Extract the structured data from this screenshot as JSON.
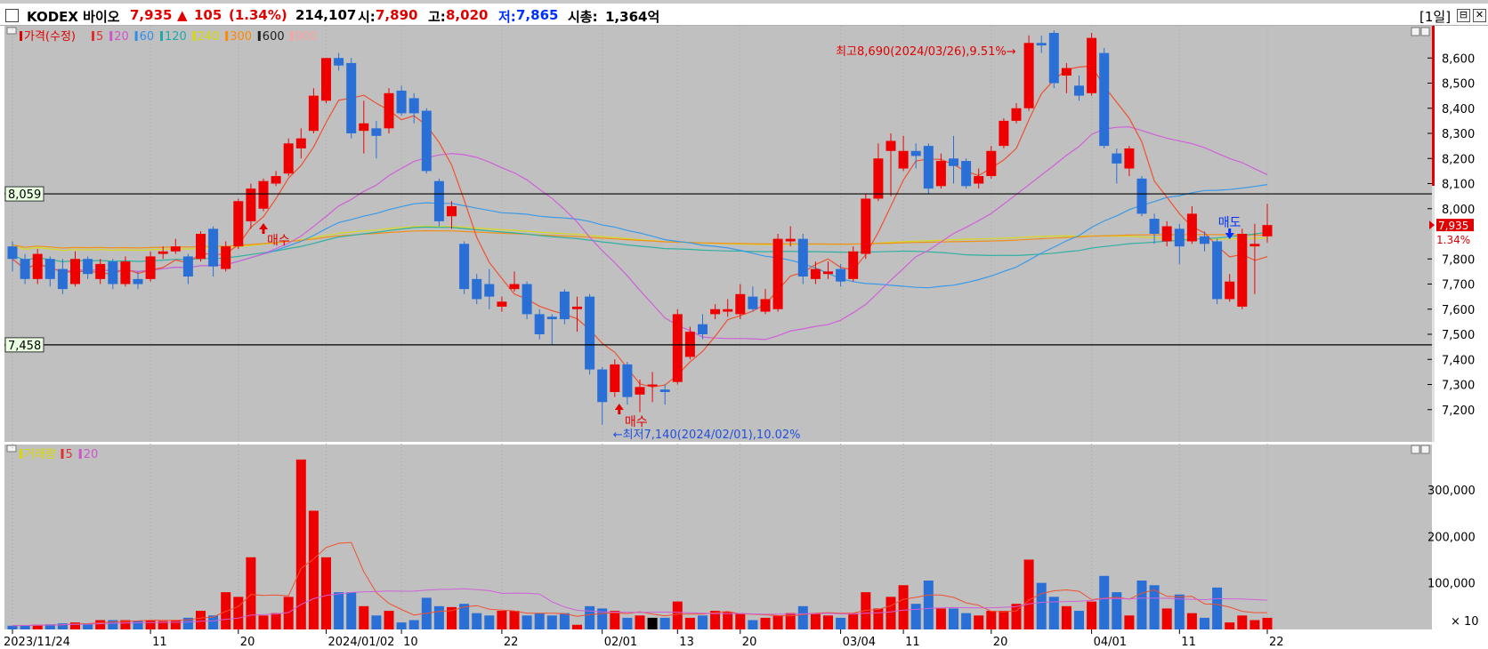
{
  "header": {
    "name": "KODEX 바이오",
    "price": "7,935",
    "change_arrow": "▲",
    "change": "105",
    "change_pct": "(1.34%)",
    "volume": "214,107",
    "open_label": "시:",
    "open": "7,890",
    "high_label": "고:",
    "high": "8,020",
    "low_label": "저:",
    "low": "7,865",
    "mcap_label": "시총:",
    "mcap": "1,364억",
    "period": "[1일]",
    "btn_restore": "⊟",
    "btn_close": "✕"
  },
  "price_legend": [
    {
      "text": "가격(수정)",
      "color": "#e00000"
    },
    {
      "text": "5",
      "color": "#e03030"
    },
    {
      "text": "20",
      "color": "#cc55cc"
    },
    {
      "text": "60",
      "color": "#2f8fe8"
    },
    {
      "text": "120",
      "color": "#20a8a8"
    },
    {
      "text": "240",
      "color": "#d8d800"
    },
    {
      "text": "300",
      "color": "#ff8800"
    },
    {
      "text": "600",
      "color": "#202020"
    },
    {
      "text": "900",
      "color": "#ffa0a0"
    }
  ],
  "volume_legend": [
    {
      "text": "거래량",
      "color": "#d8d800"
    },
    {
      "text": "5",
      "color": "#e03030"
    },
    {
      "text": "20",
      "color": "#cc55cc"
    }
  ],
  "price_axis": [
    "8,600",
    "8,500",
    "8,400",
    "8,300",
    "8,200",
    "8,100",
    "8,000",
    "7,800",
    "7,700",
    "7,600",
    "7,500",
    "7,400",
    "7,300",
    "7,200"
  ],
  "volume_axis": [
    "300,000",
    "200,000",
    "100,000"
  ],
  "volume_axis_unit": "× 10",
  "hlines": {
    "upper": "8,059",
    "lower": "7,458"
  },
  "current_price_tag": "7,935",
  "current_pct_tag": "1.34%",
  "x_labels": [
    "2023/11/24",
    "11",
    "20",
    "2024/01/02",
    "10",
    "22",
    "02/01",
    "13",
    "20",
    "03/04",
    "11",
    "20",
    "04/01",
    "11",
    "22"
  ],
  "annotations": {
    "high": "최고8,690(2024/03/26),9.51%→",
    "low": "←최저7,140(2024/02/01),10.02%",
    "buy1": "매수",
    "buy2": "매수",
    "sell": "매도"
  },
  "colors": {
    "chart_bg": "#c0c0c0",
    "up": "#ee0000",
    "down": "#2a6fd6",
    "ma5": "#f05030",
    "ma20": "#d060d8",
    "ma60": "#3a9ae8",
    "ma120": "#30b0a0",
    "ma240": "#d8d820",
    "ma300": "#f09018"
  },
  "chart_data": {
    "type": "candlestick",
    "price_ylim": [
      7100,
      8700
    ],
    "volume_ylim": [
      0,
      380000
    ],
    "candles": [
      {
        "o": 7850,
        "c": 7800,
        "h": 7870,
        "l": 7750,
        "v": 8000
      },
      {
        "o": 7800,
        "c": 7720,
        "h": 7820,
        "l": 7700,
        "v": 9000
      },
      {
        "o": 7720,
        "c": 7820,
        "h": 7840,
        "l": 7700,
        "v": 10000
      },
      {
        "o": 7800,
        "c": 7720,
        "h": 7810,
        "l": 7690,
        "v": 11000
      },
      {
        "o": 7760,
        "c": 7680,
        "h": 7800,
        "l": 7660,
        "v": 13000
      },
      {
        "o": 7700,
        "c": 7800,
        "h": 7830,
        "l": 7690,
        "v": 15000
      },
      {
        "o": 7800,
        "c": 7740,
        "h": 7810,
        "l": 7720,
        "v": 13000
      },
      {
        "o": 7720,
        "c": 7780,
        "h": 7800,
        "l": 7700,
        "v": 20000
      },
      {
        "o": 7790,
        "c": 7700,
        "h": 7800,
        "l": 7680,
        "v": 20000
      },
      {
        "o": 7700,
        "c": 7790,
        "h": 7810,
        "l": 7690,
        "v": 20000
      },
      {
        "o": 7720,
        "c": 7700,
        "h": 7750,
        "l": 7680,
        "v": 19000
      },
      {
        "o": 7720,
        "c": 7810,
        "h": 7830,
        "l": 7710,
        "v": 20000
      },
      {
        "o": 7820,
        "c": 7830,
        "h": 7850,
        "l": 7800,
        "v": 18000
      },
      {
        "o": 7830,
        "c": 7850,
        "h": 7880,
        "l": 7820,
        "v": 20000
      },
      {
        "o": 7810,
        "c": 7730,
        "h": 7820,
        "l": 7700,
        "v": 25000
      },
      {
        "o": 7800,
        "c": 7900,
        "h": 7910,
        "l": 7790,
        "v": 40000
      },
      {
        "o": 7920,
        "c": 7770,
        "h": 7930,
        "l": 7730,
        "v": 30000
      },
      {
        "o": 7760,
        "c": 7850,
        "h": 7870,
        "l": 7750,
        "v": 80000
      },
      {
        "o": 7850,
        "c": 8030,
        "h": 8040,
        "l": 7840,
        "v": 70000
      },
      {
        "o": 7950,
        "c": 8080,
        "h": 8100,
        "l": 7920,
        "v": 155000
      },
      {
        "o": 8000,
        "c": 8110,
        "h": 8120,
        "l": 7990,
        "v": 30000
      },
      {
        "o": 8100,
        "c": 8130,
        "h": 8150,
        "l": 8090,
        "v": 35000
      },
      {
        "o": 8140,
        "c": 8260,
        "h": 8280,
        "l": 8130,
        "v": 70000
      },
      {
        "o": 8240,
        "c": 8280,
        "h": 8320,
        "l": 8200,
        "v": 365000
      },
      {
        "o": 8310,
        "c": 8450,
        "h": 8480,
        "l": 8300,
        "v": 255000
      },
      {
        "o": 8430,
        "c": 8600,
        "h": 8600,
        "l": 8420,
        "v": 155000
      },
      {
        "o": 8600,
        "c": 8570,
        "h": 8620,
        "l": 8550,
        "v": 80000
      },
      {
        "o": 8580,
        "c": 8300,
        "h": 8600,
        "l": 8280,
        "v": 80000
      },
      {
        "o": 8310,
        "c": 8340,
        "h": 8430,
        "l": 8220,
        "v": 50000
      },
      {
        "o": 8320,
        "c": 8290,
        "h": 8350,
        "l": 8200,
        "v": 30000
      },
      {
        "o": 8320,
        "c": 8460,
        "h": 8480,
        "l": 8300,
        "v": 40000
      },
      {
        "o": 8470,
        "c": 8380,
        "h": 8490,
        "l": 8370,
        "v": 15000
      },
      {
        "o": 8440,
        "c": 8380,
        "h": 8460,
        "l": 8340,
        "v": 20000
      },
      {
        "o": 8390,
        "c": 8150,
        "h": 8400,
        "l": 8140,
        "v": 68000
      },
      {
        "o": 8110,
        "c": 7950,
        "h": 8120,
        "l": 7930,
        "v": 50000
      },
      {
        "o": 7970,
        "c": 8010,
        "h": 8030,
        "l": 7920,
        "v": 48000
      },
      {
        "o": 7860,
        "c": 7680,
        "h": 7870,
        "l": 7660,
        "v": 55000
      },
      {
        "o": 7720,
        "c": 7640,
        "h": 7740,
        "l": 7620,
        "v": 35000
      },
      {
        "o": 7700,
        "c": 7650,
        "h": 7760,
        "l": 7600,
        "v": 30000
      },
      {
        "o": 7610,
        "c": 7630,
        "h": 7650,
        "l": 7590,
        "v": 40000
      },
      {
        "o": 7680,
        "c": 7700,
        "h": 7750,
        "l": 7670,
        "v": 40000
      },
      {
        "o": 7700,
        "c": 7580,
        "h": 7710,
        "l": 7560,
        "v": 30000
      },
      {
        "o": 7580,
        "c": 7500,
        "h": 7600,
        "l": 7480,
        "v": 35000
      },
      {
        "o": 7570,
        "c": 7560,
        "h": 7580,
        "l": 7460,
        "v": 30000
      },
      {
        "o": 7670,
        "c": 7560,
        "h": 7680,
        "l": 7540,
        "v": 35000
      },
      {
        "o": 7600,
        "c": 7610,
        "h": 7650,
        "l": 7510,
        "v": 10000
      },
      {
        "o": 7650,
        "c": 7360,
        "h": 7660,
        "l": 7340,
        "v": 50000
      },
      {
        "o": 7360,
        "c": 7230,
        "h": 7370,
        "l": 7140,
        "v": 45000
      },
      {
        "o": 7270,
        "c": 7380,
        "h": 7400,
        "l": 7250,
        "v": 40000
      },
      {
        "o": 7380,
        "c": 7250,
        "h": 7390,
        "l": 7220,
        "v": 25000
      },
      {
        "o": 7260,
        "c": 7290,
        "h": 7320,
        "l": 7190,
        "v": 30000
      },
      {
        "o": 7300,
        "c": 7300,
        "h": 7350,
        "l": 7230,
        "v": 25000
      },
      {
        "o": 7280,
        "c": 7270,
        "h": 7300,
        "l": 7220,
        "v": 25000
      },
      {
        "o": 7310,
        "c": 7580,
        "h": 7600,
        "l": 7300,
        "v": 60000
      },
      {
        "o": 7410,
        "c": 7510,
        "h": 7530,
        "l": 7400,
        "v": 25000
      },
      {
        "o": 7540,
        "c": 7500,
        "h": 7580,
        "l": 7480,
        "v": 30000
      },
      {
        "o": 7580,
        "c": 7600,
        "h": 7620,
        "l": 7560,
        "v": 40000
      },
      {
        "o": 7590,
        "c": 7600,
        "h": 7640,
        "l": 7570,
        "v": 38000
      },
      {
        "o": 7580,
        "c": 7660,
        "h": 7700,
        "l": 7560,
        "v": 35000
      },
      {
        "o": 7650,
        "c": 7600,
        "h": 7690,
        "l": 7590,
        "v": 20000
      },
      {
        "o": 7590,
        "c": 7640,
        "h": 7680,
        "l": 7580,
        "v": 25000
      },
      {
        "o": 7600,
        "c": 7880,
        "h": 7900,
        "l": 7590,
        "v": 30000
      },
      {
        "o": 7870,
        "c": 7880,
        "h": 7930,
        "l": 7850,
        "v": 35000
      },
      {
        "o": 7880,
        "c": 7730,
        "h": 7900,
        "l": 7700,
        "v": 50000
      },
      {
        "o": 7720,
        "c": 7760,
        "h": 7790,
        "l": 7700,
        "v": 35000
      },
      {
        "o": 7740,
        "c": 7750,
        "h": 7790,
        "l": 7720,
        "v": 30000
      },
      {
        "o": 7760,
        "c": 7710,
        "h": 7780,
        "l": 7690,
        "v": 25000
      },
      {
        "o": 7720,
        "c": 7830,
        "h": 7850,
        "l": 7710,
        "v": 35000
      },
      {
        "o": 7820,
        "c": 8040,
        "h": 8060,
        "l": 7800,
        "v": 80000
      },
      {
        "o": 8040,
        "c": 8200,
        "h": 8260,
        "l": 8030,
        "v": 45000
      },
      {
        "o": 8230,
        "c": 8270,
        "h": 8300,
        "l": 8050,
        "v": 70000
      },
      {
        "o": 8160,
        "c": 8230,
        "h": 8290,
        "l": 8150,
        "v": 95000
      },
      {
        "o": 8230,
        "c": 8210,
        "h": 8260,
        "l": 8160,
        "v": 55000
      },
      {
        "o": 8250,
        "c": 8080,
        "h": 8260,
        "l": 8060,
        "v": 105000
      },
      {
        "o": 8090,
        "c": 8190,
        "h": 8220,
        "l": 8080,
        "v": 45000
      },
      {
        "o": 8200,
        "c": 8170,
        "h": 8290,
        "l": 8100,
        "v": 45000
      },
      {
        "o": 8190,
        "c": 8090,
        "h": 8200,
        "l": 8080,
        "v": 35000
      },
      {
        "o": 8100,
        "c": 8130,
        "h": 8160,
        "l": 8080,
        "v": 30000
      },
      {
        "o": 8130,
        "c": 8230,
        "h": 8250,
        "l": 8120,
        "v": 40000
      },
      {
        "o": 8250,
        "c": 8350,
        "h": 8360,
        "l": 8240,
        "v": 40000
      },
      {
        "o": 8350,
        "c": 8400,
        "h": 8420,
        "l": 8340,
        "v": 55000
      },
      {
        "o": 8400,
        "c": 8660,
        "h": 8690,
        "l": 8390,
        "v": 150000
      },
      {
        "o": 8660,
        "c": 8650,
        "h": 8690,
        "l": 8620,
        "v": 100000
      },
      {
        "o": 8700,
        "c": 8500,
        "h": 8710,
        "l": 8480,
        "v": 70000
      },
      {
        "o": 8530,
        "c": 8560,
        "h": 8580,
        "l": 8460,
        "v": 50000
      },
      {
        "o": 8490,
        "c": 8450,
        "h": 8530,
        "l": 8430,
        "v": 40000
      },
      {
        "o": 8460,
        "c": 8680,
        "h": 8700,
        "l": 8450,
        "v": 60000
      },
      {
        "o": 8620,
        "c": 8250,
        "h": 8640,
        "l": 8240,
        "v": 115000
      },
      {
        "o": 8220,
        "c": 8180,
        "h": 8240,
        "l": 8100,
        "v": 80000
      },
      {
        "o": 8160,
        "c": 8240,
        "h": 8250,
        "l": 8130,
        "v": 30000
      },
      {
        "o": 8120,
        "c": 7980,
        "h": 8130,
        "l": 7970,
        "v": 105000
      },
      {
        "o": 7960,
        "c": 7900,
        "h": 7980,
        "l": 7860,
        "v": 95000
      },
      {
        "o": 7870,
        "c": 7930,
        "h": 7950,
        "l": 7850,
        "v": 45000
      },
      {
        "o": 7920,
        "c": 7850,
        "h": 7940,
        "l": 7780,
        "v": 75000
      },
      {
        "o": 7870,
        "c": 7980,
        "h": 8010,
        "l": 7860,
        "v": 35000
      },
      {
        "o": 7890,
        "c": 7860,
        "h": 7910,
        "l": 7830,
        "v": 25000
      },
      {
        "o": 7870,
        "c": 7640,
        "h": 7880,
        "l": 7620,
        "v": 90000
      },
      {
        "o": 7640,
        "c": 7710,
        "h": 7740,
        "l": 7630,
        "v": 15000
      },
      {
        "o": 7610,
        "c": 7900,
        "h": 7920,
        "l": 7600,
        "v": 30000
      },
      {
        "o": 7850,
        "c": 7860,
        "h": 7940,
        "l": 7660,
        "v": 20000
      },
      {
        "o": 7890,
        "c": 7935,
        "h": 8020,
        "l": 7865,
        "v": 25000
      }
    ]
  }
}
